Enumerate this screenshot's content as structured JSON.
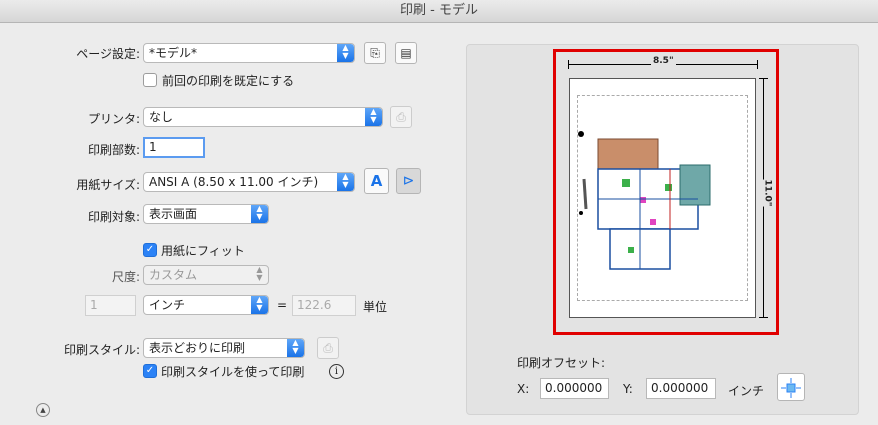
{
  "window": {
    "title": "印刷 - モデル"
  },
  "page_setup": {
    "label": "ページ設定:",
    "value": "*モデル*",
    "use_previous_label": "前回の印刷を既定にする"
  },
  "printer": {
    "label": "プリンタ:",
    "value": "なし"
  },
  "copies": {
    "label": "印刷部数:",
    "value": "1"
  },
  "paper_size": {
    "label": "用紙サイズ:",
    "value": "ANSI A (8.50 x 11.00 インチ)"
  },
  "print_area": {
    "label": "印刷対象:",
    "value": "表示画面"
  },
  "fit_to_paper": {
    "label": "用紙にフィット",
    "checked": true
  },
  "scale": {
    "label": "尺度:",
    "value": "カスタム",
    "left_value": "1",
    "unit_value": "インチ",
    "equals": "=",
    "right_value": "122.6",
    "units_label": "単位"
  },
  "plot_style": {
    "label": "印刷スタイル:",
    "value": "表示どおりに印刷",
    "use_style_label": "印刷スタイルを使って印刷",
    "use_style_checked": true,
    "info_icon": "i"
  },
  "preview": {
    "width_label": "8.5\"",
    "height_label": "11.0\"",
    "highlight_color": "#e00000"
  },
  "offset": {
    "title": "印刷オフセット:",
    "x_label": "X:",
    "x_value": "0.000000",
    "y_label": "Y:",
    "y_value": "0.000000",
    "unit": "インチ"
  },
  "colors": {
    "accent": "#2b82f6",
    "highlight": "#e00000"
  }
}
